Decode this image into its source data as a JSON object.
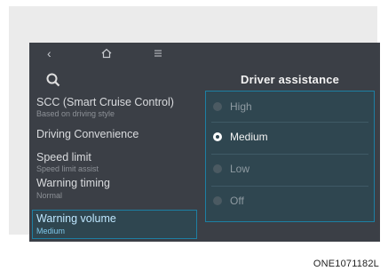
{
  "topbar": {
    "back_icon": "chevron-left-icon",
    "home_icon": "home-icon",
    "menu_icon": "menu-icon",
    "back_glyph": "‹"
  },
  "header": {
    "search_icon": "search-icon",
    "title": "Driver assistance"
  },
  "menu": {
    "items": [
      {
        "label": "SCC (Smart Cruise Control)",
        "sub": "Based on driving style"
      },
      {
        "label": "Driving Convenience",
        "sub": ""
      },
      {
        "label": "Speed limit",
        "sub": "Speed limit assist"
      },
      {
        "label": "Warning timing",
        "sub": "Normal"
      },
      {
        "label": "Warning volume",
        "sub": "Medium",
        "selected": true
      }
    ]
  },
  "options": {
    "items": [
      {
        "label": "High",
        "checked": false
      },
      {
        "label": "Medium",
        "checked": true
      },
      {
        "label": "Low",
        "checked": false
      },
      {
        "label": "Off",
        "checked": false
      }
    ]
  },
  "caption": "ONE1071182L",
  "colors": {
    "screen_bg": "#3b3f46",
    "accent": "#1d7fa3",
    "selected_bg": "#2f4650"
  }
}
